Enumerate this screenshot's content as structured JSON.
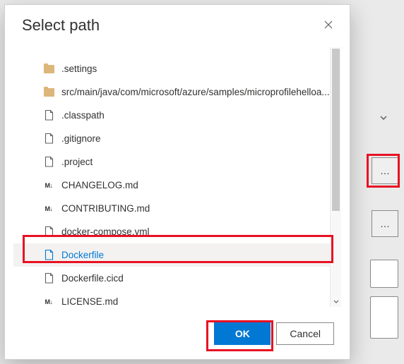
{
  "dialog": {
    "title": "Select path",
    "ok_label": "OK",
    "cancel_label": "Cancel"
  },
  "tree": {
    "items": [
      {
        "icon": "folder",
        "label": ".settings"
      },
      {
        "icon": "folder",
        "label": "src/main/java/com/microsoft/azure/samples/microprofilehelloa..."
      },
      {
        "icon": "file",
        "label": ".classpath"
      },
      {
        "icon": "file",
        "label": ".gitignore"
      },
      {
        "icon": "file",
        "label": ".project"
      },
      {
        "icon": "md",
        "label": "CHANGELOG.md"
      },
      {
        "icon": "md",
        "label": "CONTRIBUTING.md"
      },
      {
        "icon": "file",
        "label": "docker-compose.yml"
      },
      {
        "icon": "file",
        "label": "Dockerfile",
        "selected": true
      },
      {
        "icon": "file",
        "label": "Dockerfile.cicd"
      },
      {
        "icon": "md",
        "label": "LICENSE.md"
      }
    ]
  },
  "background": {
    "chevron": "⌄",
    "ellipsis1": "…",
    "ellipsis2": "…"
  }
}
